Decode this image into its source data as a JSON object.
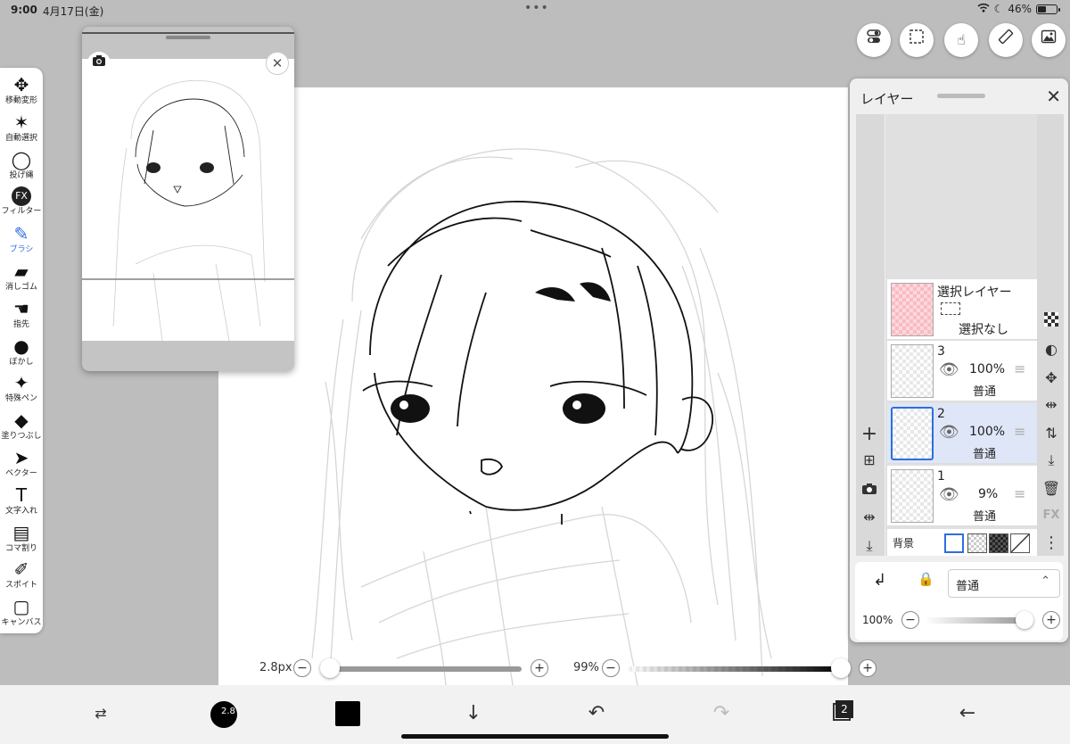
{
  "status": {
    "time": "9:00",
    "date": "4月17日(金)",
    "battery": "46%",
    "battery_level": 0.46
  },
  "tools": [
    {
      "label": "移動変形",
      "icon": "move-icon",
      "glyph": "✥"
    },
    {
      "label": "自動選択",
      "icon": "magic-wand-icon",
      "glyph": "✶"
    },
    {
      "label": "投げ縄",
      "icon": "lasso-icon",
      "glyph": "◯"
    },
    {
      "label": "フィルター",
      "icon": "fx-icon",
      "glyph": "FX"
    },
    {
      "label": "ブラシ",
      "icon": "brush-icon",
      "glyph": "✎"
    },
    {
      "label": "消しゴム",
      "icon": "eraser-icon",
      "glyph": "▰"
    },
    {
      "label": "指先",
      "icon": "finger-icon",
      "glyph": "☚"
    },
    {
      "label": "ぼかし",
      "icon": "blur-icon",
      "glyph": "●"
    },
    {
      "label": "特殊ペン",
      "icon": "special-pen-icon",
      "glyph": "✦"
    },
    {
      "label": "塗りつぶし",
      "icon": "fill-icon",
      "glyph": "◆"
    },
    {
      "label": "ベクター",
      "icon": "vector-icon",
      "glyph": "➤"
    },
    {
      "label": "文字入れ",
      "icon": "text-icon",
      "glyph": "T"
    },
    {
      "label": "コマ割り",
      "icon": "frame-divider-icon",
      "glyph": "▤"
    },
    {
      "label": "スポイト",
      "icon": "eyedropper-icon",
      "glyph": "✐"
    },
    {
      "label": "キャンバス",
      "icon": "canvas-icon",
      "glyph": "▢"
    }
  ],
  "active_tool": "ブラシ",
  "layer_panel": {
    "title": "レイヤー",
    "selection_layer": {
      "name": "選択レイヤー",
      "status": "選択なし"
    },
    "layers": [
      {
        "number": "3",
        "opacity": "100%",
        "mode": "普通",
        "selected": false
      },
      {
        "number": "2",
        "opacity": "100%",
        "mode": "普通",
        "selected": true
      },
      {
        "number": "1",
        "opacity": "9%",
        "mode": "普通",
        "selected": false
      }
    ],
    "background_label": "背景",
    "fx_label": "FX",
    "blend_mode": "普通",
    "opacity_label": "100%",
    "opacity_value": 1.0
  },
  "brush": {
    "size_label": "2.8px",
    "size_badge": "2.8",
    "opacity_label": "99%",
    "opacity_value": 0.99,
    "color": "#000000"
  },
  "bottom": {
    "layer_count": "2"
  }
}
